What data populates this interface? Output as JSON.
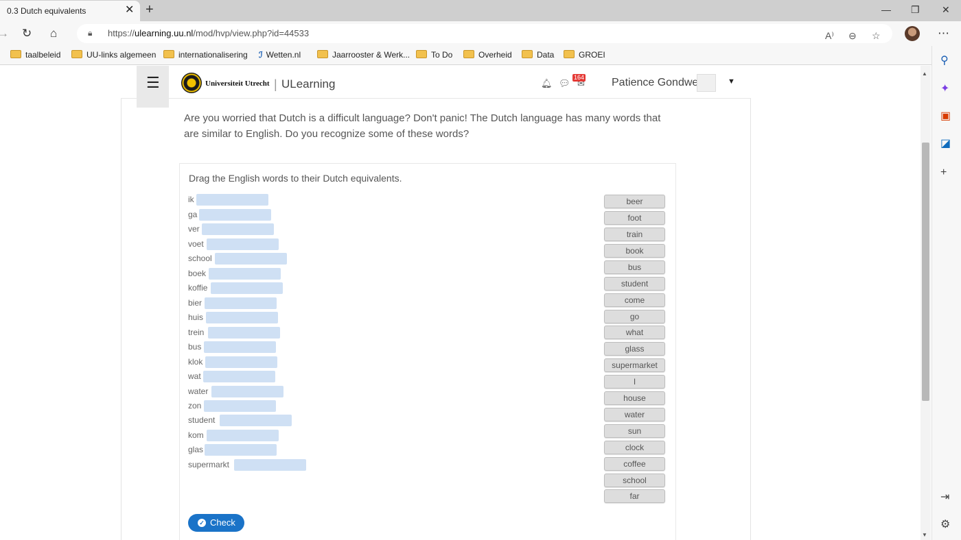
{
  "browser": {
    "tab_title": "0.3 Dutch equivalents",
    "tab_close": "✕",
    "new_tab": "+",
    "url_prefix": "https://",
    "url_host": "ulearning.uu.nl",
    "url_path": "/mod/hvp/view.php?id=44533",
    "window_controls": [
      "—",
      "❐",
      "✕"
    ]
  },
  "bookmarks": [
    {
      "label": "taalbeleid",
      "icon": "folder"
    },
    {
      "label": "UU-links algemeen",
      "icon": "folder"
    },
    {
      "label": "internationalisering",
      "icon": "folder"
    },
    {
      "label": "Wetten.nl",
      "icon": "wetten-logo"
    },
    {
      "label": "Jaarrooster & Werk...",
      "icon": "folder"
    },
    {
      "label": "To Do",
      "icon": "folder"
    },
    {
      "label": "Overheid",
      "icon": "folder"
    },
    {
      "label": "Data",
      "icon": "folder"
    },
    {
      "label": "GROEI",
      "icon": "folder"
    }
  ],
  "header": {
    "university": "Universiteit Utrecht",
    "separator": "|",
    "site_name": "ULearning",
    "notification_count": "164",
    "user_name": "Patience Gondwe"
  },
  "intro_text": "Are you worried that Dutch is a difficult language? Don't panic! The Dutch language has many words that are similar to English. Do you recognize some of these words?",
  "activity": {
    "task": "Drag the English words to their Dutch equivalents.",
    "dutch_words": [
      "ik",
      "ga",
      "ver",
      "voet",
      "school",
      "boek",
      "koffie",
      "bier",
      "huis",
      "trein",
      "bus",
      "klok",
      "wat",
      "water",
      "zon",
      "student",
      "kom",
      "glas",
      "supermarkt"
    ],
    "english_words": [
      "beer",
      "foot",
      "train",
      "book",
      "bus",
      "student",
      "come",
      "go",
      "what",
      "glass",
      "supermarket",
      "I",
      "house",
      "water",
      "sun",
      "clock",
      "coffee",
      "school",
      "far"
    ],
    "check_label": "Check"
  },
  "colors": {
    "dropzone": "#cfe0f4",
    "check_button": "#1a73c8",
    "word_chip": "#dddddd"
  }
}
